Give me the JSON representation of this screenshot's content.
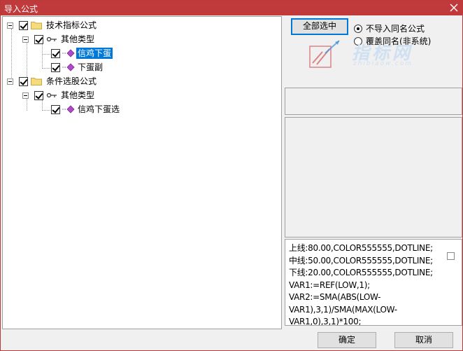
{
  "window": {
    "title": "导入公式"
  },
  "tree": {
    "nodes": [
      {
        "label": "技术指标公式",
        "selected": false
      },
      {
        "label": "其他类型",
        "selected": false
      },
      {
        "label": "信鸡下蛋",
        "selected": true
      },
      {
        "label": "下蛋副",
        "selected": false
      },
      {
        "label": "条件选股公式",
        "selected": false
      },
      {
        "label": "其他类型",
        "selected": false
      },
      {
        "label": "信鸡下蛋选",
        "selected": false
      }
    ]
  },
  "buttons": {
    "select_all": "全部选中",
    "ok": "确定",
    "cancel": "取消"
  },
  "options": {
    "no_import": "不导入同名公式",
    "overwrite": "覆盖同名(非系统)",
    "selected": "no_import"
  },
  "logo": {
    "name": "指标网",
    "url": "zhibiaow.com"
  },
  "code": {
    "lines": [
      "上线:80.00,COLOR555555,DOTLINE;",
      "中线:50.00,COLOR555555,DOTLINE;",
      "下线:20.00,COLOR555555,DOTLINE;",
      "VAR1:=REF(LOW,1);",
      "VAR2:=SMA(ABS(LOW-",
      "VAR1),3,1)/SMA(MAX(LOW-",
      "VAR1,0),3,1)*100;"
    ]
  },
  "colors": {
    "titlebar": "#c0393b",
    "selection": "#0078d7"
  }
}
